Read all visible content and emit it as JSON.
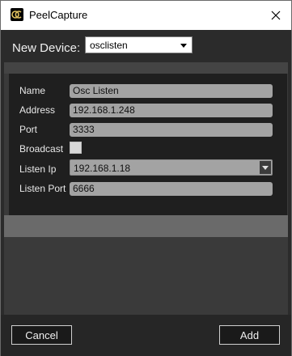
{
  "window": {
    "title": "PeelCapture",
    "app_icon": "peelcapture-logo-icon",
    "close_icon": "close-icon"
  },
  "header": {
    "new_device_label": "New Device:",
    "device_type_value": "osclisten"
  },
  "form": {
    "name_label": "Name",
    "name_value": "Osc Listen",
    "address_label": "Address",
    "address_value": "192.168.1.248",
    "port_label": "Port",
    "port_value": "3333",
    "broadcast_label": "Broadcast",
    "broadcast_checked": false,
    "listen_ip_label": "Listen Ip",
    "listen_ip_value": "192.168.1.18",
    "listen_port_label": "Listen Port",
    "listen_port_value": "6666"
  },
  "footer": {
    "cancel_label": "Cancel",
    "add_label": "Add"
  }
}
